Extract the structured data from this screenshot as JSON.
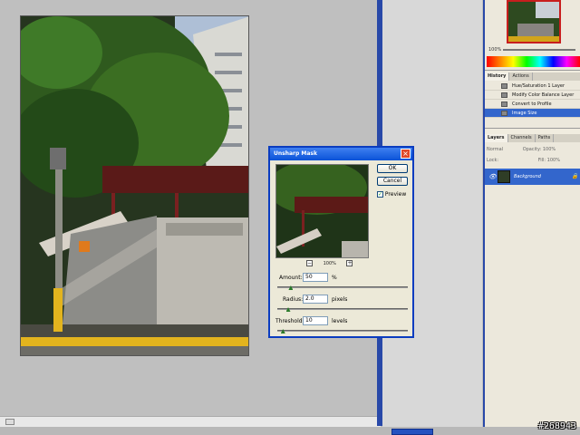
{
  "navigator": {
    "zoom_label": "100%"
  },
  "history": {
    "tabs": [
      "History",
      "Actions"
    ],
    "items": [
      {
        "label": "Hue/Saturation 1 Layer",
        "selected": false
      },
      {
        "label": "Modify Color Balance Layer",
        "selected": false
      },
      {
        "label": "Convert to Profile",
        "selected": false
      },
      {
        "label": "Image Size",
        "selected": true
      }
    ]
  },
  "layers": {
    "tabs": [
      "Layers",
      "Channels",
      "Paths"
    ],
    "blend_mode": "Normal",
    "opacity_label": "Opacity:",
    "opacity_value": "100%",
    "lock_label": "Lock:",
    "fill_label": "Fill:",
    "fill_value": "100%",
    "items": [
      {
        "name": "Background",
        "visible": true,
        "locked": true
      }
    ]
  },
  "dialog": {
    "title": "Unsharp Mask",
    "ok_label": "OK",
    "cancel_label": "Cancel",
    "preview_label": "Preview",
    "preview_checked": true,
    "zoom_out": "−",
    "zoom_level": "100%",
    "zoom_in": "+",
    "amount": {
      "label": "Amount:",
      "value": "50",
      "unit": "%",
      "slider_fraction": 0.1
    },
    "radius": {
      "label": "Radius:",
      "value": "2.0",
      "unit": "pixels",
      "slider_fraction": 0.08
    },
    "threshold": {
      "label": "Threshold:",
      "value": "10",
      "unit": "levels",
      "slider_fraction": 0.04
    }
  },
  "watermark": "#268943",
  "colors": {
    "accent": "#3366cc",
    "title_bar": "#0a52d8",
    "frame_blue": "#2848a8"
  }
}
